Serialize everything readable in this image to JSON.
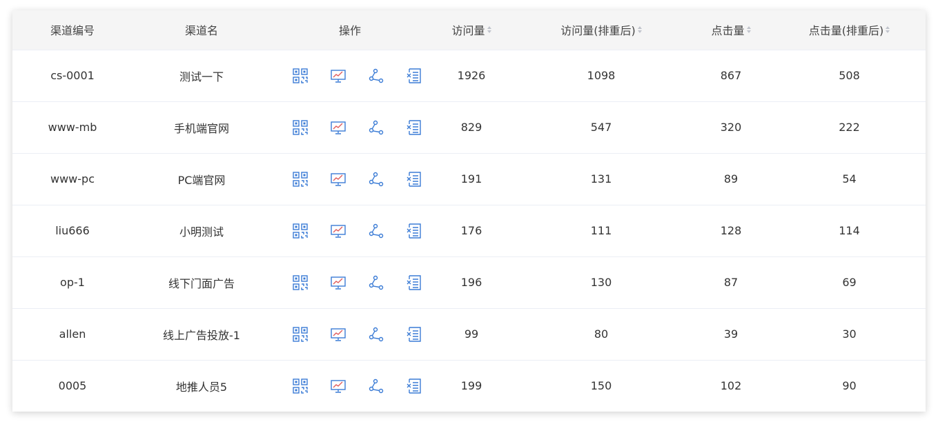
{
  "columns": {
    "channel_id": "渠道编号",
    "channel_name": "渠道名",
    "actions": "操作",
    "visits": "访问量",
    "visits_dedup": "访问量(排重后)",
    "clicks": "点击量",
    "clicks_dedup": "点击量(排重后)"
  },
  "icon_names": [
    "qrcode-icon",
    "trend-chart-icon",
    "share-icon",
    "delete-list-icon"
  ],
  "colors": {
    "icon_blue": "#3a7bd5",
    "icon_red": "#e05a5a",
    "header_bg": "#f5f5f5"
  },
  "rows": [
    {
      "channel_id": "cs-0001",
      "channel_name": "测试一下",
      "visits": "1926",
      "visits_dedup": "1098",
      "clicks": "867",
      "clicks_dedup": "508"
    },
    {
      "channel_id": "www-mb",
      "channel_name": "手机端官网",
      "visits": "829",
      "visits_dedup": "547",
      "clicks": "320",
      "clicks_dedup": "222"
    },
    {
      "channel_id": "www-pc",
      "channel_name": "PC端官网",
      "visits": "191",
      "visits_dedup": "131",
      "clicks": "89",
      "clicks_dedup": "54"
    },
    {
      "channel_id": "liu666",
      "channel_name": "小明测试",
      "visits": "176",
      "visits_dedup": "111",
      "clicks": "128",
      "clicks_dedup": "114"
    },
    {
      "channel_id": "op-1",
      "channel_name": "线下门面广告",
      "visits": "196",
      "visits_dedup": "130",
      "clicks": "87",
      "clicks_dedup": "69"
    },
    {
      "channel_id": "allen",
      "channel_name": "线上广告投放-1",
      "visits": "99",
      "visits_dedup": "80",
      "clicks": "39",
      "clicks_dedup": "30"
    },
    {
      "channel_id": "0005",
      "channel_name": "地推人员5",
      "visits": "199",
      "visits_dedup": "150",
      "clicks": "102",
      "clicks_dedup": "90"
    }
  ]
}
